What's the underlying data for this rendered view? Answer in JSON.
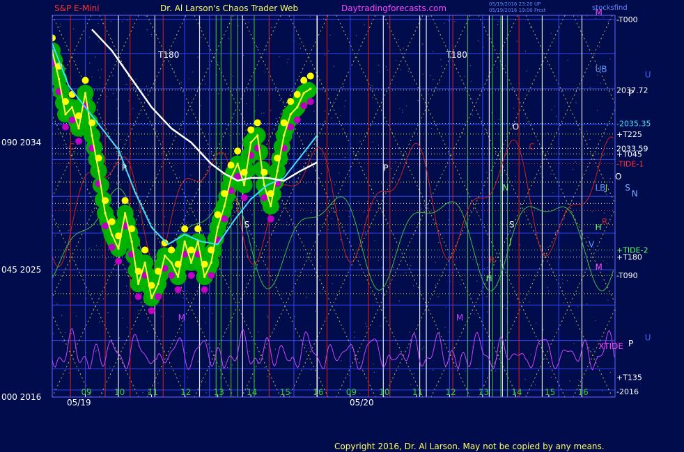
{
  "header": {
    "symbol": "S&P E-Mini",
    "site": "Dr. Al Larson's Chaos Trader Web",
    "url": "Daytradingforecasts.com",
    "stamp1": "05/19/2016 23:20 UP",
    "stamp2": "05/19/2016 19:00 Frcst",
    "short_name": "stocksfind"
  },
  "copyright": "Copyright 2016, Dr. Al Larson. May not be copied by any means.",
  "colors": {
    "background": "#000c4c",
    "frame": "#6666ff",
    "price": "#ffff44",
    "marker_green": "#00b400",
    "marker_yellow": "#ffff00",
    "marker_magenta": "#c000c0",
    "ma_cyan": "#44ddff",
    "ma_white": "#ffffff",
    "tide_red": "#cc2222",
    "tide_green": "#44bb44",
    "xtide": "#cc44ff",
    "header_red": "#ff3333",
    "header_yellow": "#ffff66",
    "header_magenta": "#ff44ff",
    "stamp_blue": "#6688ff"
  },
  "chart_data": {
    "type": "line",
    "title": "S&P E-Mini",
    "ylim": [
      2016,
      2043
    ],
    "left_axis_labels": [
      {
        "value": 2034,
        "label": "090  2034"
      },
      {
        "value": 2025,
        "label": "045  2025"
      },
      {
        "value": 2016,
        "label": "000  2016"
      }
    ],
    "dates": [
      "05/19",
      "05/20"
    ],
    "x_ticks": [
      {
        "x": 9,
        "label": "09"
      },
      {
        "x": 10,
        "label": "10"
      },
      {
        "x": 11,
        "label": "11"
      },
      {
        "x": 12,
        "label": "12"
      },
      {
        "x": 13,
        "label": "13"
      },
      {
        "x": 14,
        "label": "14"
      },
      {
        "x": 15,
        "label": "15"
      },
      {
        "x": 16,
        "label": "16"
      },
      {
        "x": 17,
        "label": "09"
      },
      {
        "x": 18,
        "label": "10"
      },
      {
        "x": 19,
        "label": "11"
      },
      {
        "x": 20,
        "label": "12"
      },
      {
        "x": 21,
        "label": "13"
      },
      {
        "x": 22,
        "label": "14"
      },
      {
        "x": 23,
        "label": "15"
      },
      {
        "x": 24,
        "label": "16"
      }
    ],
    "right_labels": [
      {
        "value": 2042.7,
        "label": "-T000",
        "color": "#ffffff"
      },
      {
        "value": 2037.72,
        "label": "2037.72",
        "color": "#ffffff"
      },
      {
        "value": 2035.35,
        "label": "-2035.35",
        "color": "#44ddff"
      },
      {
        "value": 2034.6,
        "label": "+T225",
        "color": "#ffffff"
      },
      {
        "value": 2033.59,
        "label": "2033.59",
        "color": "#ffffff"
      },
      {
        "value": 2033.2,
        "label": "+T045",
        "color": "#ffffff"
      },
      {
        "value": 2032.5,
        "label": "-TIDE-1",
        "color": "#ff3333"
      },
      {
        "value": 2026.4,
        "label": "+TIDE-2",
        "color": "#66ff66"
      },
      {
        "value": 2025.9,
        "label": "+T180",
        "color": "#ffffff"
      },
      {
        "value": 2024.6,
        "label": "-T090",
        "color": "#ffffff"
      },
      {
        "value": 2017.4,
        "label": "+T135",
        "color": "#ffffff"
      },
      {
        "value": 2016.4,
        "label": "-2016",
        "color": "#ffffff"
      }
    ],
    "series": [
      {
        "name": "",
        "x": [
          8.0,
          8.2,
          8.4,
          8.6,
          8.8,
          9.0,
          9.2,
          9.4,
          9.6,
          9.8,
          10.0,
          10.2,
          10.4,
          10.6,
          10.8,
          11.0,
          11.2,
          11.4,
          11.6,
          11.8,
          12.0,
          12.2,
          12.4,
          12.6,
          12.8,
          13.0,
          13.2,
          13.4,
          13.6,
          13.8,
          14.0,
          14.2,
          14.4,
          14.6,
          14.8,
          15.0,
          15.2,
          15.4,
          15.6,
          15.8
        ],
        "values": [
          2040.5,
          2038.5,
          2036.0,
          2036.5,
          2035.0,
          2037.5,
          2034.5,
          2032.0,
          2029.0,
          2027.5,
          2026.5,
          2029.0,
          2027.0,
          2024.0,
          2025.5,
          2023.0,
          2024.0,
          2026.0,
          2025.5,
          2024.5,
          2027.0,
          2025.5,
          2027.0,
          2024.5,
          2025.5,
          2028.0,
          2029.5,
          2031.5,
          2032.5,
          2031.0,
          2034.0,
          2034.5,
          2031.0,
          2029.5,
          2032.0,
          2034.5,
          2036.0,
          2036.5,
          2037.5,
          2037.8
        ]
      },
      {
        "name": "",
        "x": [
          8.0,
          8.5,
          9.0,
          9.5,
          10.0,
          10.5,
          11.0,
          11.5,
          12.0,
          12.5,
          13.0,
          13.5,
          14.0,
          14.5,
          15.0,
          15.5,
          16.0
        ],
        "values": [
          2041.0,
          2038.0,
          2036.5,
          2035.0,
          2033.5,
          2030.5,
          2028.0,
          2026.8,
          2027.5,
          2027.0,
          2026.8,
          2028.5,
          2030.0,
          2031.0,
          2031.5,
          2033.0,
          2034.5
        ]
      },
      {
        "name": "",
        "x": [
          9.2,
          9.8,
          10.4,
          11.0,
          11.6,
          12.2,
          12.8,
          13.2,
          13.6,
          14.0,
          14.5,
          15.0,
          15.5,
          16.0
        ],
        "values": [
          2042.0,
          2040.5,
          2038.5,
          2036.5,
          2035.0,
          2034.0,
          2032.5,
          2031.8,
          2031.3,
          2031.5,
          2031.5,
          2031.3,
          2032.0,
          2032.6
        ]
      }
    ]
  },
  "annotations": [
    {
      "text": "T180",
      "x": 11.2,
      "value": 2040.0,
      "color": "#ffffff"
    },
    {
      "text": "T180",
      "x": 19.9,
      "value": 2040.0,
      "color": "#ffffff"
    },
    {
      "text": "UB",
      "x": 24.4,
      "value": 2039.0,
      "color": "#6699ff"
    },
    {
      "text": "P",
      "x": 25.4,
      "value": 2037.3,
      "color": "#ffffff"
    },
    {
      "text": "O",
      "x": 21.9,
      "value": 2034.9,
      "color": "#ffffff"
    },
    {
      "text": "C",
      "x": 8.5,
      "value": 2033.5,
      "color": "#cc2222"
    },
    {
      "text": "C",
      "x": 22.4,
      "value": 2033.5,
      "color": "#cc2222"
    },
    {
      "text": "P",
      "x": 10.1,
      "value": 2032.0,
      "color": "#ffffff"
    },
    {
      "text": "P",
      "x": 18.0,
      "value": 2032.0,
      "color": "#ffffff"
    },
    {
      "text": "O",
      "x": 25.0,
      "value": 2031.4,
      "color": "#ffffff"
    },
    {
      "text": "LB",
      "x": 24.4,
      "value": 2030.6,
      "color": "#6699ff"
    },
    {
      "text": "J",
      "x": 24.7,
      "value": 2030.6,
      "color": "#88cc44"
    },
    {
      "text": "S",
      "x": 25.3,
      "value": 2030.6,
      "color": "#88aaff"
    },
    {
      "text": "N",
      "x": 25.5,
      "value": 2030.2,
      "color": "#88aaff"
    },
    {
      "text": "N",
      "x": 21.6,
      "value": 2030.6,
      "color": "#66ff66"
    },
    {
      "text": "H",
      "x": 24.4,
      "value": 2027.8,
      "color": "#66ff66"
    },
    {
      "text": "R",
      "x": 24.6,
      "value": 2028.2,
      "color": "#cc2222"
    },
    {
      "text": "V",
      "x": 24.2,
      "value": 2026.6,
      "color": "#6699ff"
    },
    {
      "text": "S",
      "x": 13.8,
      "value": 2028.0,
      "color": "#ffffff"
    },
    {
      "text": "S",
      "x": 21.8,
      "value": 2028.0,
      "color": "#ffffff"
    },
    {
      "text": "J",
      "x": 21.8,
      "value": 2026.8,
      "color": "#88cc44"
    },
    {
      "text": "M",
      "x": 11.8,
      "value": 2021.4,
      "color": "#cc44ff"
    },
    {
      "text": "M",
      "x": 20.2,
      "value": 2021.4,
      "color": "#cc44ff"
    },
    {
      "text": "M",
      "x": 24.4,
      "value": 2025.0,
      "color": "#ff44ff"
    },
    {
      "text": "R",
      "x": 21.2,
      "value": 2025.5,
      "color": "#cc2222"
    },
    {
      "text": "H",
      "x": 21.1,
      "value": 2024.2,
      "color": "#66ff66"
    },
    {
      "text": "M",
      "x": 24.4,
      "value": 2043.0,
      "color": "#ff44ff"
    },
    {
      "text": "U",
      "x": 25.9,
      "value": 2038.6,
      "color": "#4466ff"
    },
    {
      "text": "U",
      "x": 25.9,
      "value": 2020.0,
      "color": "#4466ff"
    },
    {
      "text": "XTIDE",
      "x": 24.5,
      "value": 2019.4,
      "color": "#ff44ff"
    },
    {
      "text": "P",
      "x": 25.4,
      "value": 2019.6,
      "color": "#ffffff"
    }
  ]
}
